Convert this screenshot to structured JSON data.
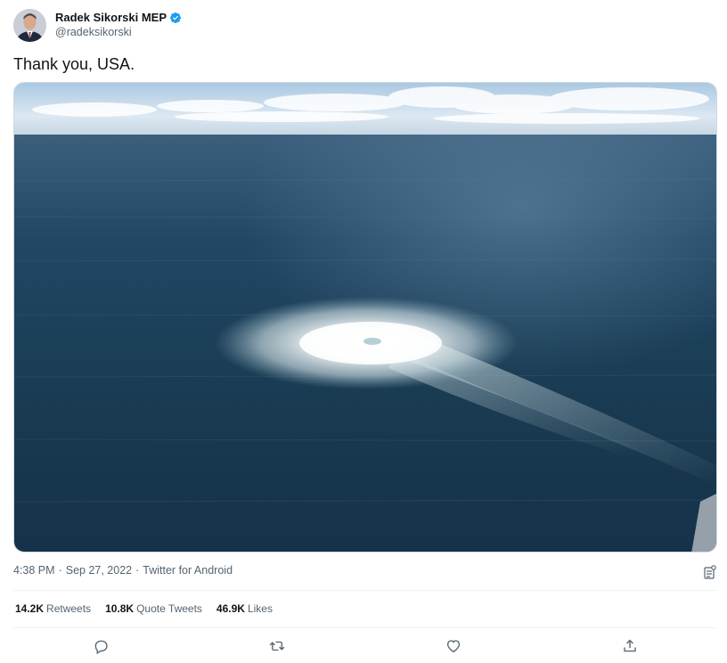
{
  "author": {
    "name": "Radek Sikorski MEP",
    "handle": "@radeksikorski",
    "verified": true,
    "verified_color": "#1d9bf0"
  },
  "tweet": {
    "text": "Thank you, USA."
  },
  "media": {
    "kind": "photo"
  },
  "meta": {
    "time": "4:38 PM",
    "separator": "·",
    "date": "Sep 27, 2022",
    "source": "Twitter for Android"
  },
  "stats": {
    "retweets_count": "14.2K",
    "retweets_label": "Retweets",
    "quotes_count": "10.8K",
    "quotes_label": "Quote Tweets",
    "likes_count": "46.9K",
    "likes_label": "Likes"
  },
  "icons": {
    "verified": "verified-badge-icon",
    "analytics": "analytics-icon",
    "reply": "reply-icon",
    "retweet": "retweet-icon",
    "like": "heart-icon",
    "share": "share-icon"
  },
  "colors": {
    "text_primary": "#0f1419",
    "text_secondary": "#536471",
    "border": "#eff3f4"
  }
}
